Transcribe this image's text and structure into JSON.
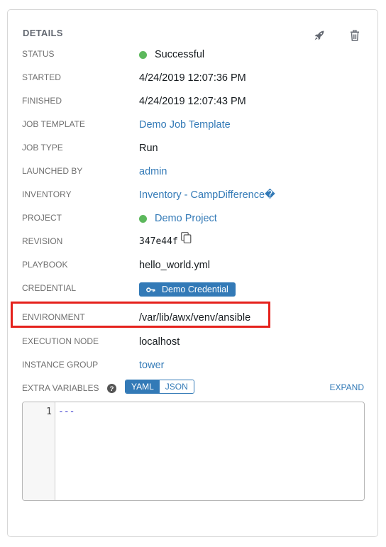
{
  "panel": {
    "title": "DETAILS",
    "actions": {
      "relaunch_icon": "rocket-icon",
      "delete_icon": "trash-icon"
    }
  },
  "details": {
    "status": {
      "label": "STATUS",
      "value": "Successful",
      "color": "#5cb85c"
    },
    "started": {
      "label": "STARTED",
      "value": "4/24/2019 12:07:36 PM"
    },
    "finished": {
      "label": "FINISHED",
      "value": "4/24/2019 12:07:43 PM"
    },
    "job_template": {
      "label": "JOB TEMPLATE",
      "value": "Demo Job Template"
    },
    "job_type": {
      "label": "JOB TYPE",
      "value": "Run"
    },
    "launched_by": {
      "label": "LAUNCHED BY",
      "value": "admin"
    },
    "inventory": {
      "label": "INVENTORY",
      "value": "Inventory - CampDifference�"
    },
    "project": {
      "label": "PROJECT",
      "value": "Demo Project",
      "color": "#5cb85c"
    },
    "revision": {
      "label": "REVISION",
      "value": "347e44f"
    },
    "playbook": {
      "label": "PLAYBOOK",
      "value": "hello_world.yml"
    },
    "credential": {
      "label": "CREDENTIAL",
      "value": "Demo Credential"
    },
    "environment": {
      "label": "ENVIRONMENT",
      "value": "/var/lib/awx/venv/ansible"
    },
    "execution_node": {
      "label": "EXECUTION NODE",
      "value": "localhost"
    },
    "instance_group": {
      "label": "INSTANCE GROUP",
      "value": "tower"
    }
  },
  "extra_variables": {
    "label": "EXTRA VARIABLES",
    "yaml_label": "YAML",
    "json_label": "JSON",
    "selected": "YAML",
    "expand_label": "EXPAND",
    "line_number": "1",
    "content": "---"
  },
  "colors": {
    "accent": "#337ab7",
    "success": "#5cb85c",
    "highlight": "#e5211c"
  }
}
